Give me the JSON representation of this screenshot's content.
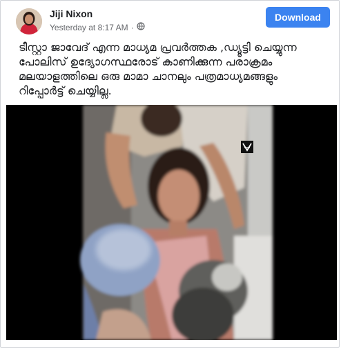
{
  "post": {
    "author": "Jiji Nixon",
    "timestamp": "Yesterday at 8:17 AM",
    "separator": "·",
    "audience_icon": "globe-icon",
    "download_label": "Download",
    "text_lines": [
      "ടീസ്റ്റാ ജാവേദ് എന്ന മാധ്യമ പ്രവർത്തക ,ഡ്യൂട്ടി ചെയ്യുന്ന",
      "പോലിസ് ഉദ്യോഗസ്ഥരോട് കാണിക്കുന്ന പരാക്രമം",
      "മലയാളത്തിലെ ഒരു മാമാ ചാനലും പത്രമാധ്യമങ്ങളും",
      "റിപ്പോർട്ട് ചെയ്യില്ല."
    ]
  },
  "colors": {
    "accent": "#3b83f0",
    "text": "#1c1e21",
    "meta": "#65676b"
  }
}
